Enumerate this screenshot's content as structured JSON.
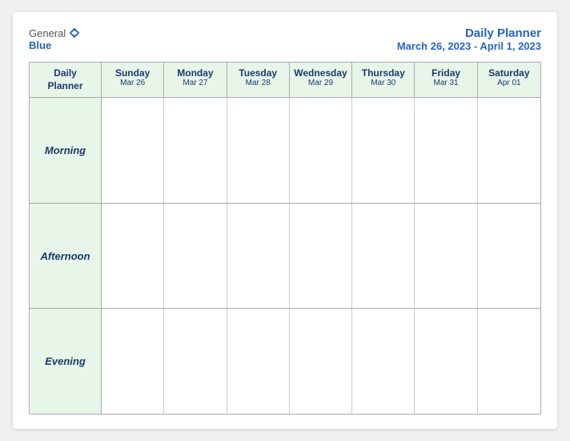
{
  "logo": {
    "general": "General",
    "blue": "Blue",
    "icon": "▶"
  },
  "title": {
    "main": "Daily Planner",
    "date_range": "March 26, 2023 - April 1, 2023"
  },
  "header_row": {
    "first_col": {
      "line1": "Daily",
      "line2": "Planner"
    },
    "days": [
      {
        "name": "Sunday",
        "date": "Mar 26"
      },
      {
        "name": "Monday",
        "date": "Mar 27"
      },
      {
        "name": "Tuesday",
        "date": "Mar 28"
      },
      {
        "name": "Wednesday",
        "date": "Mar 29"
      },
      {
        "name": "Thursday",
        "date": "Mar 30"
      },
      {
        "name": "Friday",
        "date": "Mar 31"
      },
      {
        "name": "Saturday",
        "date": "Apr 01"
      }
    ]
  },
  "time_slots": [
    {
      "label": "Morning"
    },
    {
      "label": "Afternoon"
    },
    {
      "label": "Evening"
    }
  ]
}
